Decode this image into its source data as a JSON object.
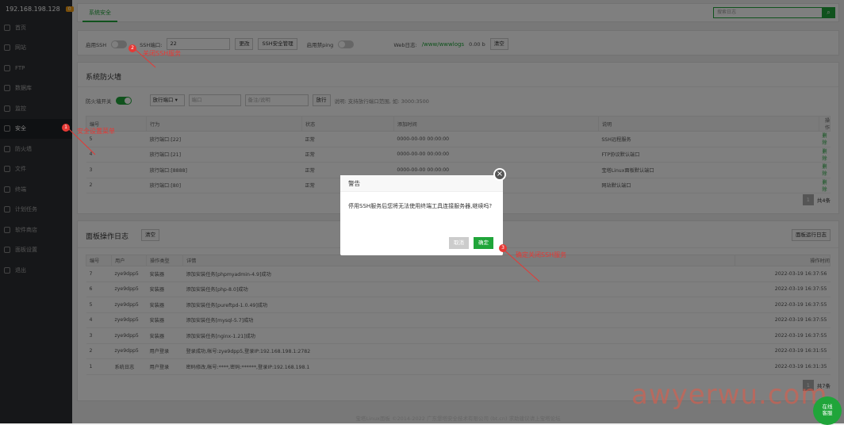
{
  "sidebar": {
    "ip": "192.168.198.128",
    "badge": "0",
    "items": [
      {
        "label": "首页"
      },
      {
        "label": "网站"
      },
      {
        "label": "FTP"
      },
      {
        "label": "数据库"
      },
      {
        "label": "监控"
      },
      {
        "label": "安全"
      },
      {
        "label": "防火墙"
      },
      {
        "label": "文件"
      },
      {
        "label": "终端"
      },
      {
        "label": "计划任务"
      },
      {
        "label": "软件商店"
      },
      {
        "label": "面板设置"
      },
      {
        "label": "退出"
      }
    ]
  },
  "top": {
    "tab": "系统安全",
    "search_placeholder": "搜索日志"
  },
  "ssh": {
    "enable_label": "启用SSH",
    "port_label": "SSH端口:",
    "port_value": "22",
    "change_btn": "更改",
    "manage_btn": "SSH安全管理",
    "ping_label": "启用禁ping",
    "weblog_label": "Web日志:",
    "weblog_path": "/www/wwwlogs",
    "weblog_size": "0.00 b",
    "clear_btn": "清空"
  },
  "firewall": {
    "title": "系统防火墙",
    "switch_label": "防火墙开关",
    "select_value": "放行端口",
    "port_placeholder": "端口",
    "note_placeholder": "备注/说明",
    "allow_btn": "放行",
    "hint": "说明: 支持放行端口范围, 如: 3000:3500",
    "columns": [
      "编号",
      "行为",
      "状态",
      "添加时间",
      "说明",
      "操作"
    ],
    "rows": [
      {
        "id": "5",
        "action": "放行端口:[22]",
        "status": "正常",
        "time": "0000-00-00 00:00:00",
        "desc": "SSH远程服务",
        "op": "删除"
      },
      {
        "id": "4",
        "action": "放行端口:[21]",
        "status": "正常",
        "time": "0000-00-00 00:00:00",
        "desc": "FTP协议默认端口",
        "op": "删除"
      },
      {
        "id": "3",
        "action": "放行端口:[8888]",
        "status": "正常",
        "time": "0000-00-00 00:00:00",
        "desc": "宝塔Linux面板默认端口",
        "op": "删除"
      },
      {
        "id": "2",
        "action": "放行端口:[80]",
        "status": "正常",
        "time": "",
        "desc": "网站默认端口",
        "op": "删除"
      }
    ],
    "page": "1",
    "total": "共4条"
  },
  "logs": {
    "title": "面板操作日志",
    "clear_btn": "清空",
    "run_log_btn": "面板运行日志",
    "columns": [
      "编号",
      "用户",
      "操作类型",
      "详情",
      "操作时间"
    ],
    "rows": [
      {
        "id": "7",
        "user": "zye9dpp5",
        "type": "安装器",
        "detail": "添加安装任务[phpmyadmin-4.9]成功",
        "time": "2022-03-19 16:37:56"
      },
      {
        "id": "6",
        "user": "zye9dpp5",
        "type": "安装器",
        "detail": "添加安装任务[php-8.0]成功",
        "time": "2022-03-19 16:37:55"
      },
      {
        "id": "5",
        "user": "zye9dpp5",
        "type": "安装器",
        "detail": "添加安装任务[pureftpd-1.0.49]成功",
        "time": "2022-03-19 16:37:55"
      },
      {
        "id": "4",
        "user": "zye9dpp5",
        "type": "安装器",
        "detail": "添加安装任务[mysql-5.7]成功",
        "time": "2022-03-19 16:37:55"
      },
      {
        "id": "3",
        "user": "zye9dpp5",
        "type": "安装器",
        "detail": "添加安装任务[nginx-1.21]成功",
        "time": "2022-03-19 16:37:55"
      },
      {
        "id": "2",
        "user": "zye9dpp5",
        "type": "用户登录",
        "detail": "登录成功,帐号:zye9dpp5,登录IP:192.168.198.1:2782",
        "time": "2022-03-19 16:31:55"
      },
      {
        "id": "1",
        "user": "系统日志",
        "type": "用户登录",
        "detail": "密码修改,帐号:****,密码:******,登录IP:192.168.198.1",
        "time": "2022-03-19 16:31:35"
      }
    ],
    "page": "1",
    "total": "共7条"
  },
  "dialog": {
    "title": "警告",
    "message": "停用SSH服务后您将无法使用终端工具连接服务器,继续吗?",
    "cancel": "取消",
    "confirm": "确定"
  },
  "annotations": {
    "a1": "安全设置菜单",
    "a2": "关闭SSH服务",
    "a3": "确定关闭SSH服务",
    "m1": "1",
    "m2": "2",
    "m3": "3"
  },
  "watermark": "awyerwu.com",
  "chat": {
    "line1": "在线",
    "line2": "客服"
  },
  "footer": "宝塔Linux面板 ©2014-2022 广东堡塔安全技术有限公司 (bt.cn)  求助建议请上宝塔论坛",
  "colors": {
    "accent": "#20a53a",
    "sidebar": "#2c2f33",
    "annotation": "#e53935"
  }
}
